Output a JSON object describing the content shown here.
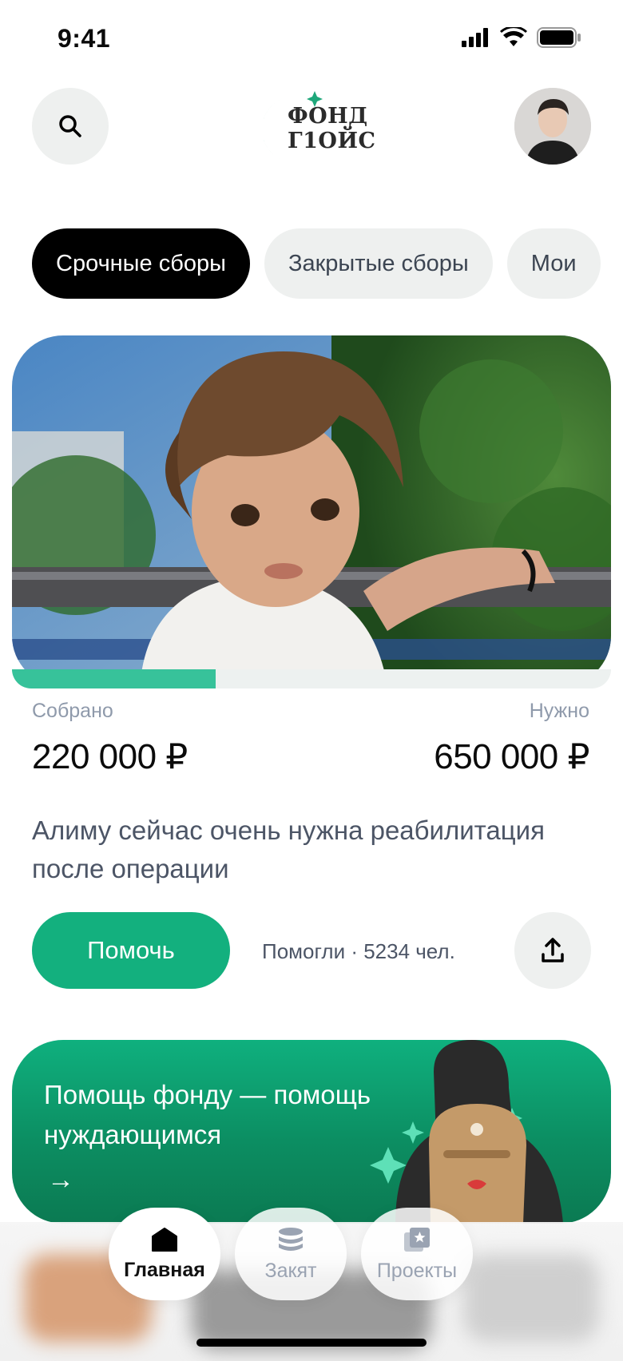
{
  "status_bar": {
    "time": "9:41"
  },
  "header": {
    "logo_line1": "ФОНД",
    "logo_line2": "Г1ОЙС"
  },
  "tabs": [
    {
      "label": "Срочные сборы",
      "active": true
    },
    {
      "label": "Закрытые сборы",
      "active": false
    },
    {
      "label": "Мои",
      "active": false
    }
  ],
  "campaign": {
    "progress": 0.34,
    "collected_label": "Собрано",
    "collected_value": "220 000 ₽",
    "needed_label": "Нужно",
    "needed_value": "650 000 ₽",
    "description": "Алиму сейчас очень нужна реабилитация после операции",
    "help_button": "Помочь",
    "helped_count": "Помогли · 5234 чел."
  },
  "promo": {
    "text": "Помощь фонду — помощь нуждающимся",
    "arrow": "→"
  },
  "bottom_nav": [
    {
      "label": "Главная",
      "icon": "home-icon",
      "active": true
    },
    {
      "label": "Закят",
      "icon": "coins-icon",
      "active": false
    },
    {
      "label": "Проекты",
      "icon": "projects-icon",
      "active": false
    }
  ],
  "colors": {
    "accent": "#13b07e",
    "progress": "#37c29a",
    "tab_active": "#000000",
    "muted_text": "#8f9aab"
  }
}
